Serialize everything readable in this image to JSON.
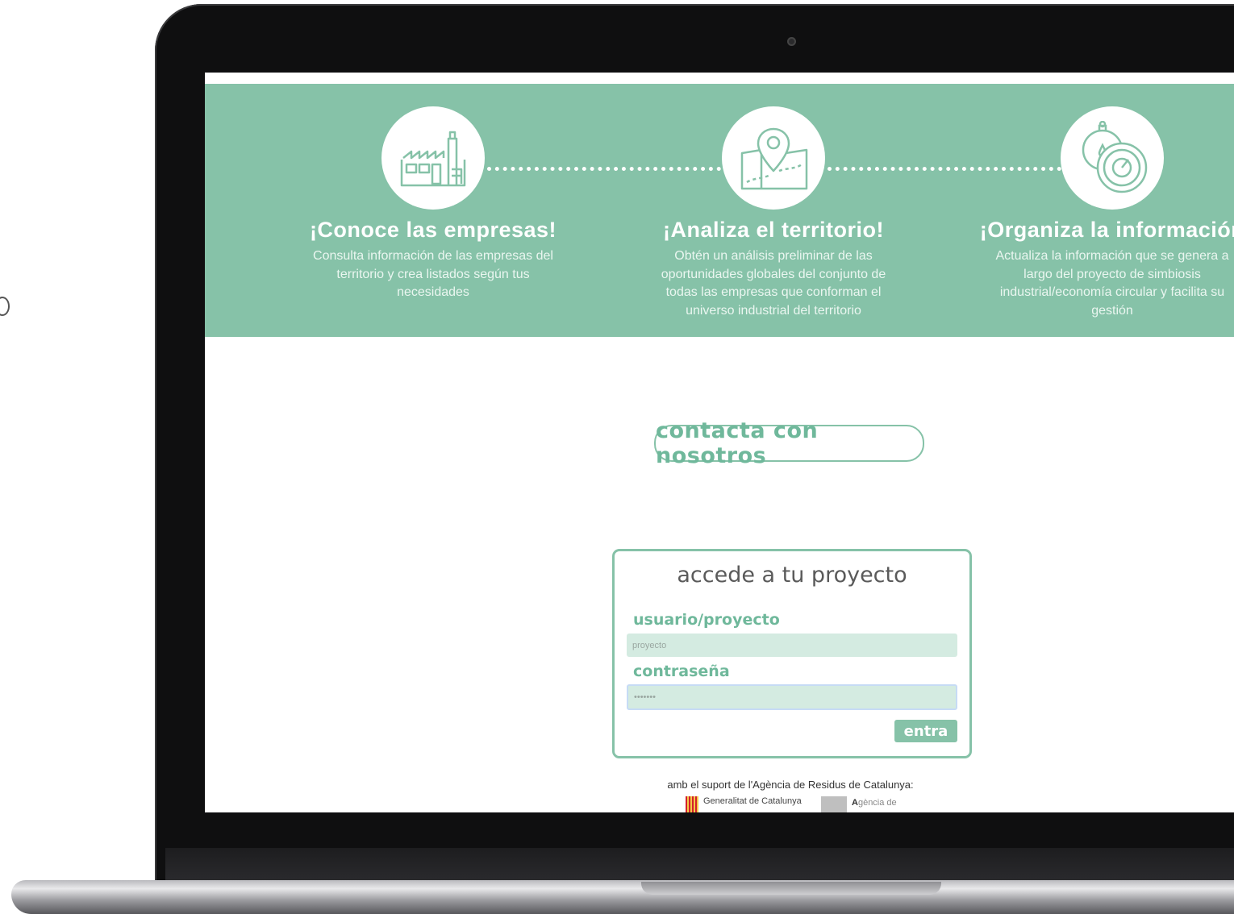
{
  "features": [
    {
      "icon": "factory-icon",
      "title": "¡Conoce las empresas!",
      "description": "Consulta información de las empresas del territorio y crea listados según tus necesidades"
    },
    {
      "icon": "map-pin-icon",
      "title": "¡Analiza el territorio!",
      "description": "Obtén un análisis preliminar de las oportunidades globales del conjunto de todas las empresas que conforman el universo industrial del territorio"
    },
    {
      "icon": "gauge-icon",
      "title": "¡Organiza la información",
      "description": "Actualiza la información que se genera a largo del proyecto de simbiosis industrial/economía circular y facilita su gestión"
    }
  ],
  "contact": {
    "label": "contacta con nosotros"
  },
  "login": {
    "title": "accede a tu proyecto",
    "user_label": "usuario/proyecto",
    "user_value": "proyecto",
    "password_label": "contraseña",
    "password_value": "•••••••",
    "submit_label": "entra"
  },
  "footer": {
    "support_text": "amb el suport de l'Agència de Residus de Catalunya:",
    "logo1_text": "Generalitat de Catalunya",
    "logo2_text_bold": "A",
    "logo2_text": "gència de"
  },
  "colors": {
    "accent": "#86c2a8",
    "accent_text": "#6fb89b",
    "input_bg": "#d4ebe1"
  }
}
